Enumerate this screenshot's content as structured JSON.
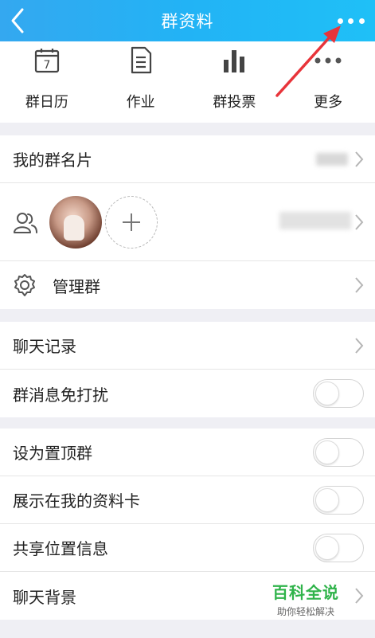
{
  "header": {
    "title": "群资料",
    "back_icon": "chevron-left-icon",
    "more_icon": "more-horizontal-icon",
    "background": "#2bb0f4"
  },
  "quick_actions": [
    {
      "label": "群日历",
      "icon": "calendar-icon",
      "badge": "7"
    },
    {
      "label": "作业",
      "icon": "document-icon"
    },
    {
      "label": "群投票",
      "icon": "bar-chart-icon"
    },
    {
      "label": "更多",
      "icon": "more-horizontal-icon"
    }
  ],
  "rows": {
    "card": {
      "label": "我的群名片"
    },
    "members": {
      "icon": "members-icon",
      "add_icon": "plus-icon"
    },
    "manage": {
      "label": "管理群",
      "icon": "gear-icon"
    },
    "chat_history": {
      "label": "聊天记录"
    },
    "mute": {
      "label": "群消息免打扰",
      "on": false
    },
    "pin": {
      "label": "设为置顶群",
      "on": false
    },
    "show_on_card": {
      "label": "展示在我的资料卡",
      "on": false
    },
    "share_location": {
      "label": "共享位置信息",
      "on": false
    },
    "chat_bg": {
      "label": "聊天背景"
    }
  },
  "watermark": {
    "title": "百科全说",
    "subtitle": "助你轻松解决"
  },
  "colors": {
    "accent": "#2bb0f4",
    "annotation_arrow": "#e8343a",
    "watermark_green": "#2fb34a"
  }
}
